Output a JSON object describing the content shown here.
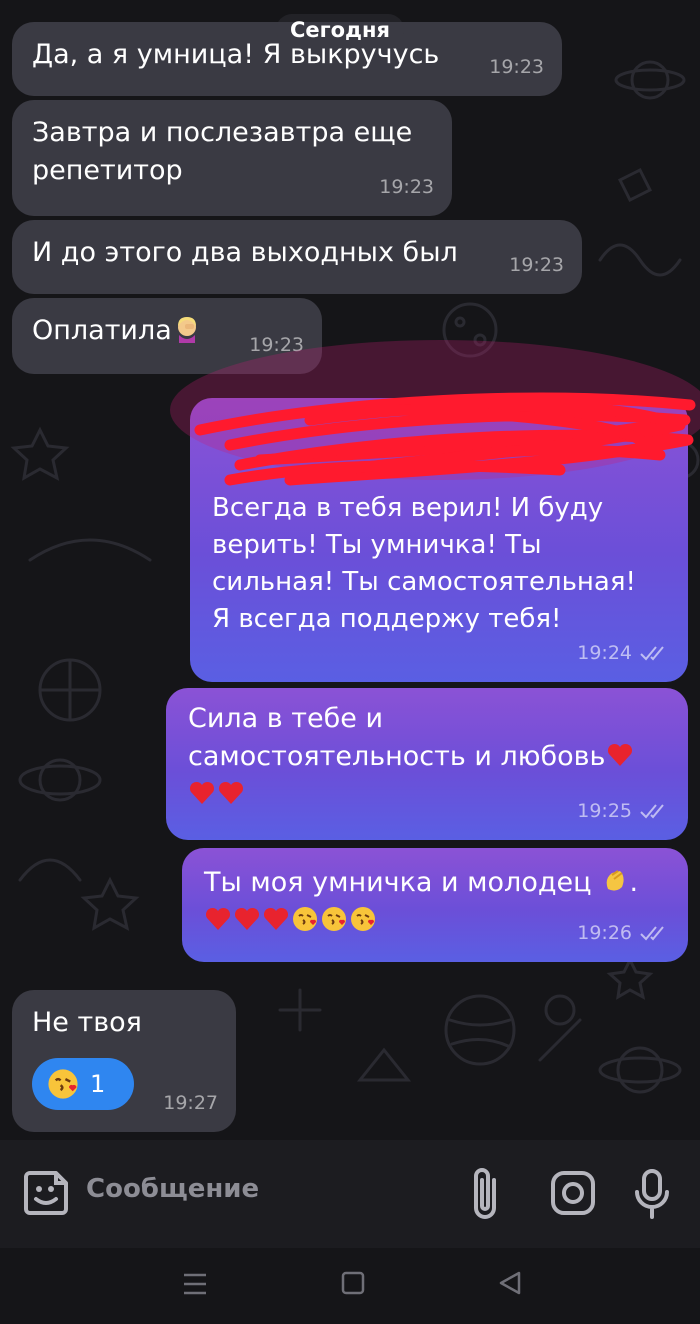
{
  "date_separator": "Сегодня",
  "messages": [
    {
      "direction": "incoming",
      "text": "Да, а я умница! Я выкручусь",
      "time": "19:23"
    },
    {
      "direction": "incoming",
      "text": "Завтра и послезавтра еще\nрепетитор",
      "time": "19:23"
    },
    {
      "direction": "incoming",
      "text": "И до этого два выходных был",
      "time": "19:23"
    },
    {
      "direction": "incoming",
      "text": "Оплатила",
      "emoji": "facepalm-woman-emoji",
      "time": "19:23"
    },
    {
      "direction": "outgoing",
      "text": "Всегда в тебя верил! И буду\nверить! Ты умничка! Ты\nсильная! Ты самостоятельная!\nЯ всегда поддержу тебя!",
      "time": "19:24",
      "status": "read",
      "redacted_by_scribble": true
    },
    {
      "direction": "outgoing",
      "text": "Сила в тебе и\nсамостоятельность и любовь",
      "emojis": [
        "red-heart",
        "red-heart",
        "red-heart"
      ],
      "time": "19:25",
      "status": "read"
    },
    {
      "direction": "outgoing",
      "text": "Ты моя умничка и молодец",
      "emojis": [
        "clapping-hands",
        "red-heart",
        "red-heart",
        "red-heart",
        "face-blowing-kiss",
        "face-blowing-kiss",
        "face-blowing-kiss"
      ],
      "time": "19:26",
      "status": "read"
    },
    {
      "direction": "incoming",
      "text": "Не твоя",
      "time": "19:27",
      "reaction": {
        "emoji": "face-blowing-kiss",
        "count": "1"
      }
    }
  ],
  "composer": {
    "placeholder": "Сообщение",
    "icons": [
      "sticker-icon",
      "attach-icon",
      "camera-icon",
      "microphone-icon"
    ]
  },
  "nav": {
    "icons": [
      "recent-apps-icon",
      "home-icon",
      "back-icon"
    ]
  },
  "colors": {
    "background": "#151518",
    "incoming_bubble": "#3a3a43",
    "outgoing_gradient": [
      "#8b52d6",
      "#5a5fe3"
    ],
    "reaction": "#2f86f0",
    "scribble": "#ff1a2e"
  }
}
